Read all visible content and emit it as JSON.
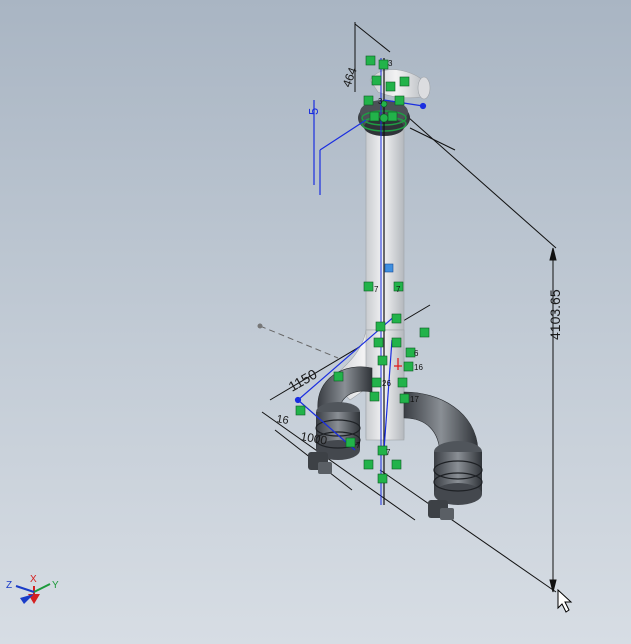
{
  "viewport": {
    "background_top": "#a9b5c3",
    "background_bottom": "#d7dde4"
  },
  "dimensions": {
    "overall_height": "4103.65",
    "top_flange_offset": "464",
    "top_offset": "5",
    "branch_width": "1150",
    "branch_offset": "1000",
    "spacing_label": "16"
  },
  "relation_labels": {
    "r1": "3",
    "r2": "3",
    "r3": "7",
    "r4": "7",
    "r5": "6",
    "r6": "16",
    "r7": "26",
    "r8": "17",
    "r9": "7",
    "r10": "7"
  },
  "triad": {
    "x_label": "X",
    "y_label": "Y",
    "z_label": "Z",
    "x_color": "#d42020",
    "y_color": "#1c9a3a",
    "z_color": "#1a3cc8"
  },
  "colors": {
    "pipe": "#e9e9ea",
    "pipe_shadow": "#b9bcc0",
    "fitting_dark": "#555a60",
    "relation_green": "#22b34a",
    "sketch_blue": "#1a2ee0",
    "dimension_line": "#111111"
  }
}
